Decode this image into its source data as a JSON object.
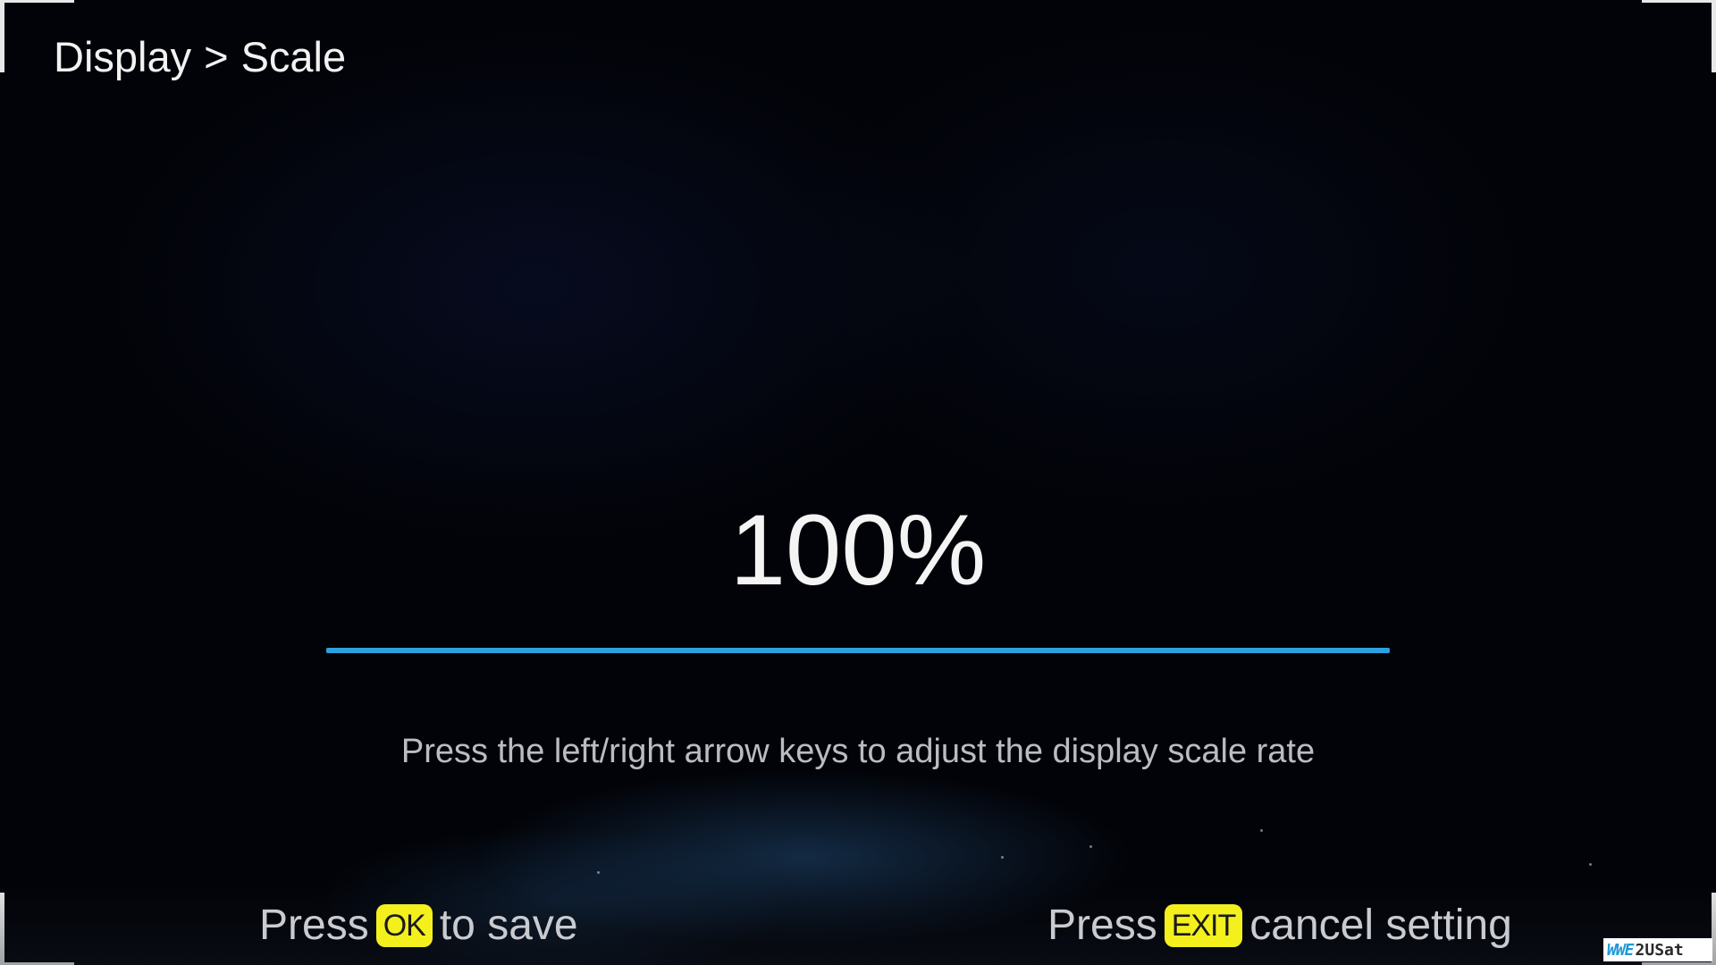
{
  "breadcrumb": {
    "parent": "Display",
    "separator": ">",
    "current": "Scale"
  },
  "scale": {
    "value_label": "100%",
    "level_percent": 100
  },
  "hint": {
    "text": "Press the left/right arrow keys to adjust the display scale rate"
  },
  "footer": {
    "save": {
      "prefix": "Press",
      "key": "OK",
      "suffix": "to save"
    },
    "cancel": {
      "prefix": "Press",
      "key": "EXIT",
      "suffix": "cancel setting"
    }
  },
  "watermark": {
    "logo": "WWE",
    "text": "2USat"
  },
  "colors": {
    "accent": "#2aa2e0",
    "key_badge": "#f3f01e",
    "background": "#020308"
  }
}
